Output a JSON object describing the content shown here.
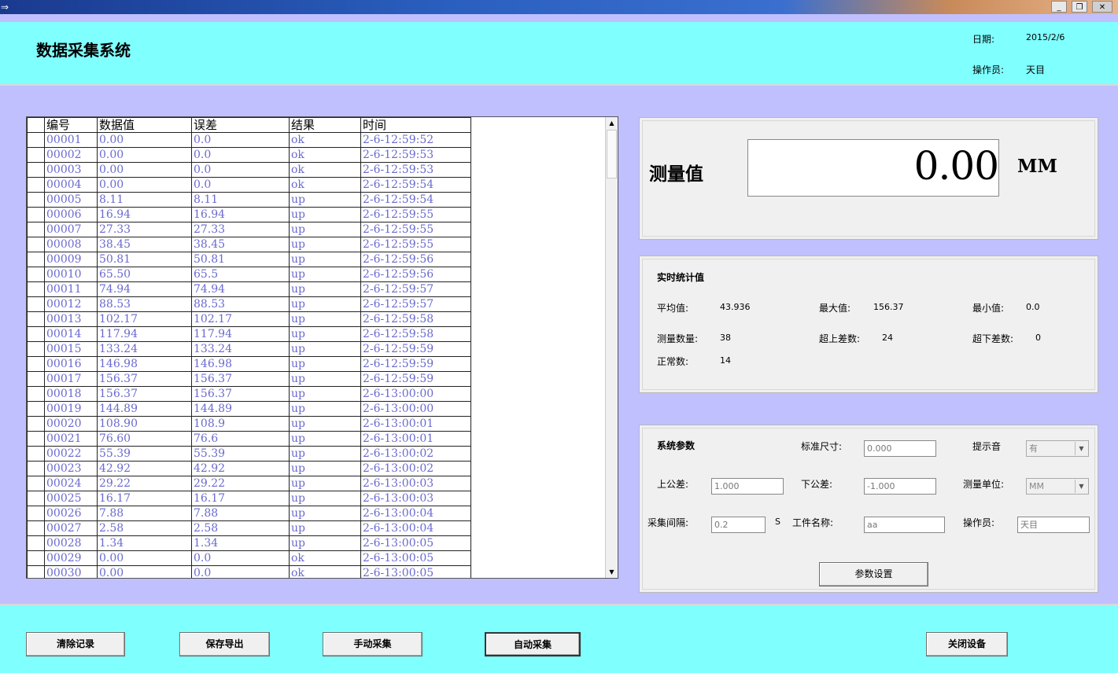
{
  "titlebar": {
    "minimize": "_",
    "restore": "❐",
    "close": "✕"
  },
  "header": {
    "app_title": "数据采集系统",
    "date_label": "日期:",
    "date_value": "2015/2/6",
    "operator_label": "操作员:",
    "operator_value": "天目"
  },
  "table": {
    "columns": [
      "编号",
      "数据值",
      "误差",
      "结果",
      "时间"
    ],
    "rows": [
      [
        "00001",
        "0.00",
        "0.0",
        "ok",
        "2-6-12:59:52"
      ],
      [
        "00002",
        "0.00",
        "0.0",
        "ok",
        "2-6-12:59:53"
      ],
      [
        "00003",
        "0.00",
        "0.0",
        "ok",
        "2-6-12:59:53"
      ],
      [
        "00004",
        "0.00",
        "0.0",
        "ok",
        "2-6-12:59:54"
      ],
      [
        "00005",
        "8.11",
        "8.11",
        "up",
        "2-6-12:59:54"
      ],
      [
        "00006",
        "16.94",
        "16.94",
        "up",
        "2-6-12:59:55"
      ],
      [
        "00007",
        "27.33",
        "27.33",
        "up",
        "2-6-12:59:55"
      ],
      [
        "00008",
        "38.45",
        "38.45",
        "up",
        "2-6-12:59:55"
      ],
      [
        "00009",
        "50.81",
        "50.81",
        "up",
        "2-6-12:59:56"
      ],
      [
        "00010",
        "65.50",
        "65.5",
        "up",
        "2-6-12:59:56"
      ],
      [
        "00011",
        "74.94",
        "74.94",
        "up",
        "2-6-12:59:57"
      ],
      [
        "00012",
        "88.53",
        "88.53",
        "up",
        "2-6-12:59:57"
      ],
      [
        "00013",
        "102.17",
        "102.17",
        "up",
        "2-6-12:59:58"
      ],
      [
        "00014",
        "117.94",
        "117.94",
        "up",
        "2-6-12:59:58"
      ],
      [
        "00015",
        "133.24",
        "133.24",
        "up",
        "2-6-12:59:59"
      ],
      [
        "00016",
        "146.98",
        "146.98",
        "up",
        "2-6-12:59:59"
      ],
      [
        "00017",
        "156.37",
        "156.37",
        "up",
        "2-6-12:59:59"
      ],
      [
        "00018",
        "156.37",
        "156.37",
        "up",
        "2-6-13:00:00"
      ],
      [
        "00019",
        "144.89",
        "144.89",
        "up",
        "2-6-13:00:00"
      ],
      [
        "00020",
        "108.90",
        "108.9",
        "up",
        "2-6-13:00:01"
      ],
      [
        "00021",
        "76.60",
        "76.6",
        "up",
        "2-6-13:00:01"
      ],
      [
        "00022",
        "55.39",
        "55.39",
        "up",
        "2-6-13:00:02"
      ],
      [
        "00023",
        "42.92",
        "42.92",
        "up",
        "2-6-13:00:02"
      ],
      [
        "00024",
        "29.22",
        "29.22",
        "up",
        "2-6-13:00:03"
      ],
      [
        "00025",
        "16.17",
        "16.17",
        "up",
        "2-6-13:00:03"
      ],
      [
        "00026",
        "7.88",
        "7.88",
        "up",
        "2-6-13:00:04"
      ],
      [
        "00027",
        "2.58",
        "2.58",
        "up",
        "2-6-13:00:04"
      ],
      [
        "00028",
        "1.34",
        "1.34",
        "up",
        "2-6-13:00:05"
      ],
      [
        "00029",
        "0.00",
        "0.0",
        "ok",
        "2-6-13:00:05"
      ],
      [
        "00030",
        "0.00",
        "0.0",
        "ok",
        "2-6-13:00:05"
      ]
    ]
  },
  "measurement": {
    "label": "测量值",
    "value": "0.00",
    "unit": "MM"
  },
  "stats": {
    "title": "实时统计值",
    "avg_label": "平均值:",
    "avg_value": "43.936",
    "max_label": "最大值:",
    "max_value": "156.37",
    "min_label": "最小值:",
    "min_value": "0.0",
    "count_label": "测量数量:",
    "count_value": "38",
    "over_upper_label": "超上差数:",
    "over_upper_value": "24",
    "over_lower_label": "超下差数:",
    "over_lower_value": "0",
    "normal_label": "正常数:",
    "normal_value": "14"
  },
  "params": {
    "title": "系统参数",
    "std_size_label": "标准尺寸:",
    "std_size_value": "0.000",
    "beep_label": "提示音",
    "beep_value": "有",
    "upper_tol_label": "上公差:",
    "upper_tol_value": "1.000",
    "lower_tol_label": "下公差:",
    "lower_tol_value": "-1.000",
    "unit_label": "测量单位:",
    "unit_value": "MM",
    "interval_label": "采集间隔:",
    "interval_value": "0.2",
    "interval_unit": "S",
    "part_name_label": "工件名称:",
    "part_name_value": "aa",
    "operator_label": "操作员:",
    "operator_value": "天目",
    "apply_button": "参数设置"
  },
  "footer": {
    "clear_button": "清除记录",
    "save_button": "保存导出",
    "manual_button": "手动采集",
    "auto_button": "自动采集",
    "close_button": "关闭设备"
  }
}
